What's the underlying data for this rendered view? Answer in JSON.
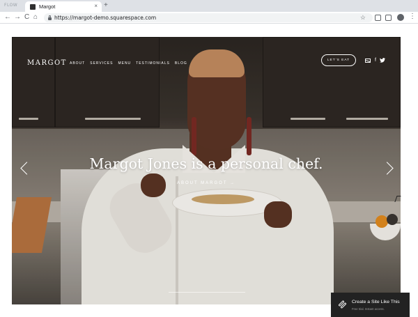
{
  "window": {
    "label": "FLOW"
  },
  "tab": {
    "title": "Margot",
    "close": "×",
    "new": "+"
  },
  "toolbar": {
    "back": "←",
    "forward": "→",
    "reload": "C",
    "home": "⌂",
    "url": "https://margot-demo.squarespace.com",
    "star": "☆",
    "menu": "⋮"
  },
  "site": {
    "logo": "MARGOT",
    "nav": [
      "ABOUT",
      "SERVICES",
      "MENU",
      "TESTIMONIALS",
      "BLOG"
    ],
    "cta": "LET'S EAT",
    "social_facebook": "f",
    "headline": "Margot Jones is a personal chef.",
    "sublink": "ABOUT MARGOT →"
  },
  "badge": {
    "title": "Create a Site Like This",
    "subtitle": "Free trial. Instant access."
  },
  "colors": {
    "badge_bg": "#222222",
    "hero_dark": "#2b2622",
    "coat": "#efece6"
  },
  "icons": [
    "lock-icon",
    "star-icon",
    "mail-icon",
    "facebook-icon",
    "twitter-icon",
    "arrow-left-icon",
    "arrow-right-icon",
    "squarespace-logo-icon"
  ]
}
